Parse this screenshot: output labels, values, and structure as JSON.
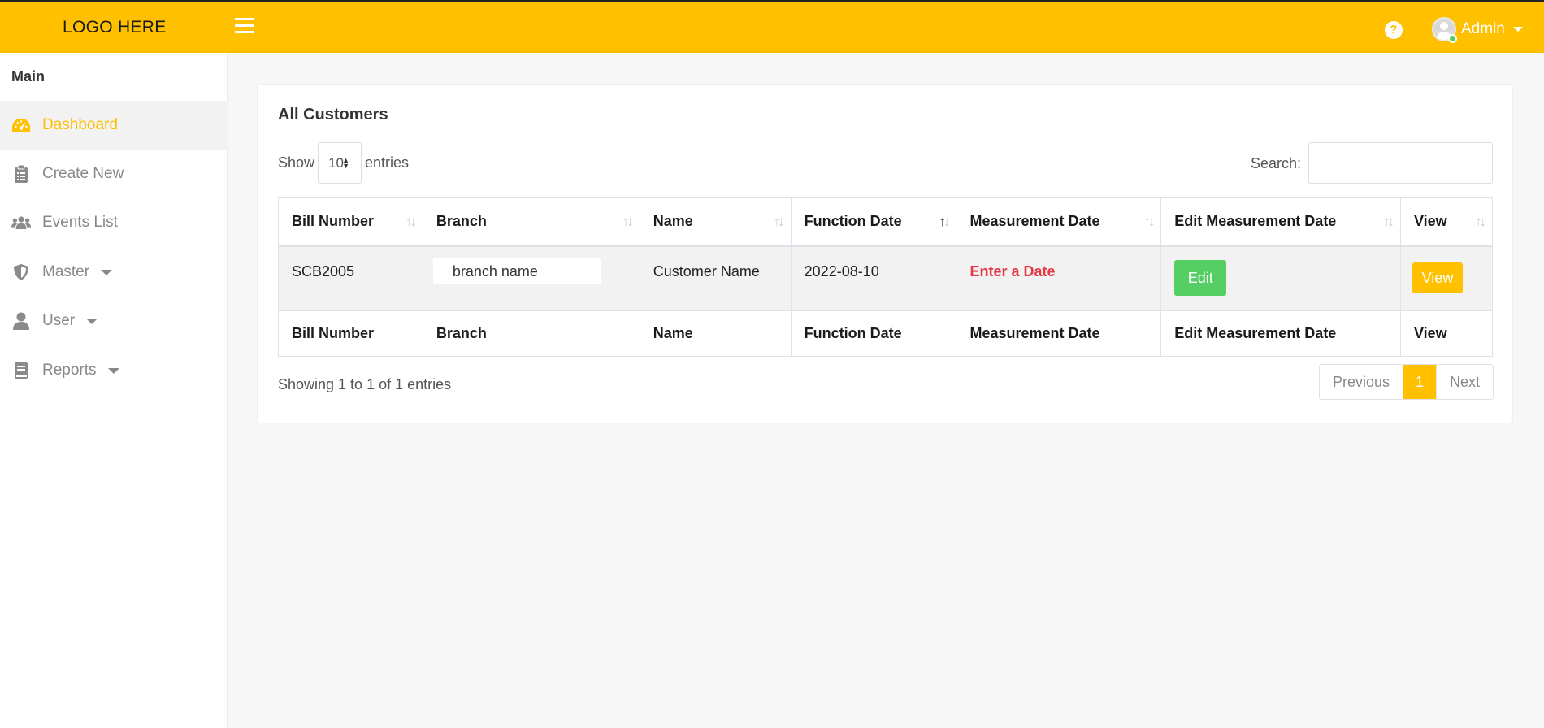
{
  "header": {
    "logo_text": "LOGO HERE",
    "user_name": "Admin"
  },
  "sidebar": {
    "title": "Main",
    "items": [
      {
        "label": "Dashboard",
        "icon": "dashboard-icon",
        "active": true
      },
      {
        "label": "Create New",
        "icon": "clipboard-icon"
      },
      {
        "label": "Events List",
        "icon": "users-icon"
      },
      {
        "label": "Master",
        "icon": "shield-icon",
        "has_dropdown": true
      },
      {
        "label": "User",
        "icon": "user-icon",
        "has_dropdown": true
      },
      {
        "label": "Reports",
        "icon": "book-icon",
        "has_dropdown": true
      }
    ]
  },
  "card": {
    "title": "All Customers",
    "show_label": "Show",
    "page_length": "10",
    "entries_label": "entries",
    "search_label": "Search:",
    "search_value": ""
  },
  "table": {
    "columns": [
      "Bill Number",
      "Branch",
      "Name",
      "Function Date",
      "Measurement Date",
      "Edit Measurement Date",
      "View"
    ],
    "sorted_column": "Function Date",
    "rows": [
      {
        "bill_number": "SCB2005",
        "branch": "branch name",
        "name": "Customer Name",
        "function_date": "2022-08-10",
        "measurement_date": "Enter a Date",
        "edit_label": "Edit",
        "view_label": "View"
      }
    ]
  },
  "footer": {
    "info": "Showing 1 to 1 of 1 entries",
    "prev_label": "Previous",
    "current_page": "1",
    "next_label": "Next"
  },
  "colors": {
    "accent": "#ffc000",
    "edit_button": "#55ce63",
    "alert_text": "#e63946"
  }
}
